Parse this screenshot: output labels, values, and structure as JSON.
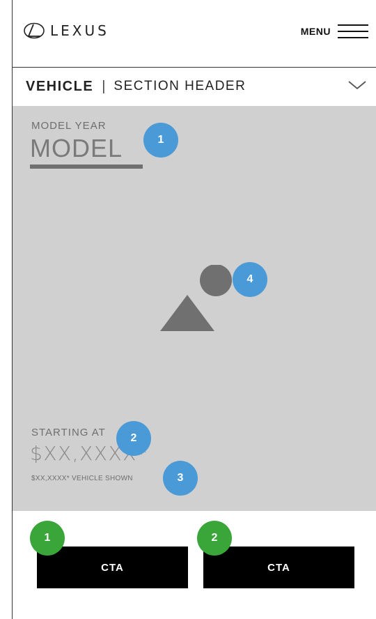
{
  "header": {
    "brand": "LEXUS",
    "menu_label": "MENU"
  },
  "section_bar": {
    "vehicle_label": "VEHICLE",
    "divider": "|",
    "section_title": "SECTION HEADER"
  },
  "hero": {
    "model_year": "MODEL YEAR",
    "model": "MODEL",
    "starting_at": "STARTING AT",
    "price": "$XX,XXXX*",
    "vehicle_shown": "$XX,XXXX* VEHICLE SHOWN",
    "image_placeholder": "image-placeholder-icon"
  },
  "annotations": {
    "blue": [
      "1",
      "2",
      "3",
      "4"
    ],
    "green": [
      "1",
      "2"
    ]
  },
  "ctas": [
    {
      "label": "CTA"
    },
    {
      "label": "CTA"
    }
  ],
  "colors": {
    "hero_bg": "#d0d0d0",
    "badge_blue": "#4a9ad8",
    "badge_green": "#3aa63a",
    "cta_bg": "#000000"
  }
}
